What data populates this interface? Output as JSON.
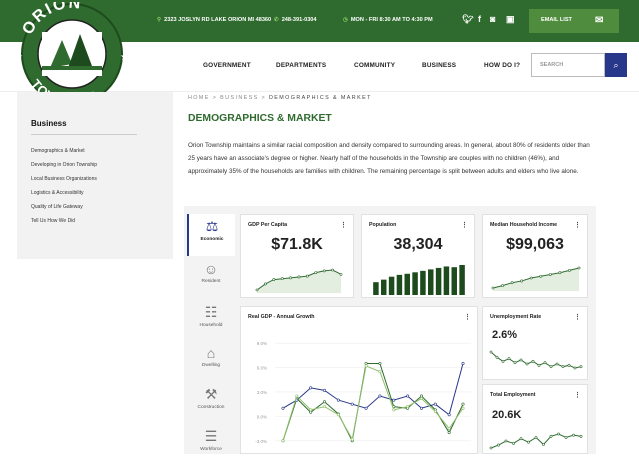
{
  "topbar": {
    "address": "2323 JOSLYN RD LAKE ORION MI 48360",
    "phone": "248-391-0304",
    "hours": "MON - FRI 8:30 AM TO 4:30 PM",
    "email_label": "EMAIL LIST",
    "social_icons": [
      "twitter-icon",
      "facebook-icon",
      "instagram-icon",
      "youtube-icon"
    ]
  },
  "logo": {
    "top_text": "ORION",
    "bottom_text": "TOWNSHIP"
  },
  "nav": {
    "items": [
      "GOVERNMENT",
      "DEPARTMENTS",
      "COMMUNITY",
      "BUSINESS",
      "HOW DO I?"
    ],
    "search_placeholder": "SEARCH"
  },
  "sidebar": {
    "title": "Business",
    "items": [
      "Demographics & Market",
      "Developing in Orion Township",
      "Local Business Organizations",
      "Logistics & Accessibility",
      "Quality of Life Gateway",
      "Tell Us How We Did"
    ]
  },
  "breadcrumb": {
    "home": "HOME",
    "sep": ">",
    "business": "BUSINESS",
    "current": "DEMOGRAPHICS & MARKET"
  },
  "page_title": "DEMOGRAPHICS & MARKET",
  "intro": "Orion Township maintains a similar racial composition and density compared to surrounding areas. In general, about 80% of residents older than 25 years have an associate's degree or higher. Nearly half of the households in the Township are couples with no children (46%), and approximately 35% of the households are families with children. The remaining percentage is split between adults and elders who live alone.",
  "tabs": [
    "Economic",
    "Resident",
    "Household",
    "Dwelling",
    "Construction",
    "Workforce"
  ],
  "colors": {
    "green": "#2f6b2f",
    "navy": "#27378a",
    "light_green": "#8fd06b"
  },
  "cards": {
    "gdp_per_capita": {
      "title": "GDP Per Capita",
      "value": "$71.8K",
      "menu": "⋮"
    },
    "population": {
      "title": "Population",
      "value": "38,304",
      "menu": "⋮"
    },
    "median_income": {
      "title": "Median Household Income",
      "value": "$99,063",
      "menu": "⋮"
    },
    "real_gdp": {
      "title": "Real GDP - Annual Growth",
      "menu": "⋮"
    },
    "unemployment": {
      "title": "Unemployment Rate",
      "value": "2.6%",
      "menu": "⋮"
    },
    "employment": {
      "title": "Total Employment",
      "value": "20.6K",
      "menu": "⋮"
    }
  },
  "chart_data": [
    {
      "type": "area",
      "title": "GDP Per Capita",
      "values": [
        50,
        57,
        62,
        63,
        64,
        65,
        66,
        70,
        72,
        73,
        68
      ]
    },
    {
      "type": "bar",
      "title": "Population",
      "values": [
        35,
        42,
        50,
        55,
        58,
        62,
        66,
        70,
        74,
        78,
        76,
        82
      ]
    },
    {
      "type": "area",
      "title": "Median Household Income",
      "values": [
        40,
        44,
        49,
        52,
        57,
        60,
        63,
        66,
        70,
        74
      ]
    },
    {
      "type": "line",
      "title": "Real GDP - Annual Growth",
      "yticks": [
        "9.0%",
        "6.0%",
        "3.0%",
        "0.0%",
        "-3.0%"
      ],
      "ylim": [
        -4.5,
        10
      ],
      "series": [
        {
          "color": "#2f6b2f",
          "values": [
            -3.0,
            2.2,
            0.5,
            1.8,
            0.3,
            -3.0,
            6.5,
            6.5,
            1.2,
            1.0,
            2.5,
            0.8,
            -2.0,
            1.5
          ]
        },
        {
          "color": "#27378a",
          "values": [
            1.0,
            2.0,
            3.5,
            3.2,
            2.0,
            1.5,
            1.0,
            2.5,
            2.0,
            2.5,
            1.0,
            1.5,
            0.2,
            6.5
          ]
        },
        {
          "color": "#8fbf6a",
          "values": [
            -3.0,
            2.5,
            0.8,
            1.2,
            0.2,
            -2.8,
            6.2,
            5.5,
            0.8,
            1.2,
            2.2,
            0.6,
            -1.5,
            1.0
          ]
        }
      ]
    },
    {
      "type": "line",
      "title": "Unemployment Rate",
      "values": [
        80,
        72,
        66,
        70,
        64,
        68,
        62,
        66,
        60,
        64,
        58,
        62,
        58,
        60,
        56,
        58
      ]
    },
    {
      "type": "line",
      "title": "Total Employment",
      "values": [
        40,
        45,
        52,
        48,
        56,
        50,
        58,
        46,
        60,
        64,
        58,
        62,
        60
      ]
    }
  ]
}
